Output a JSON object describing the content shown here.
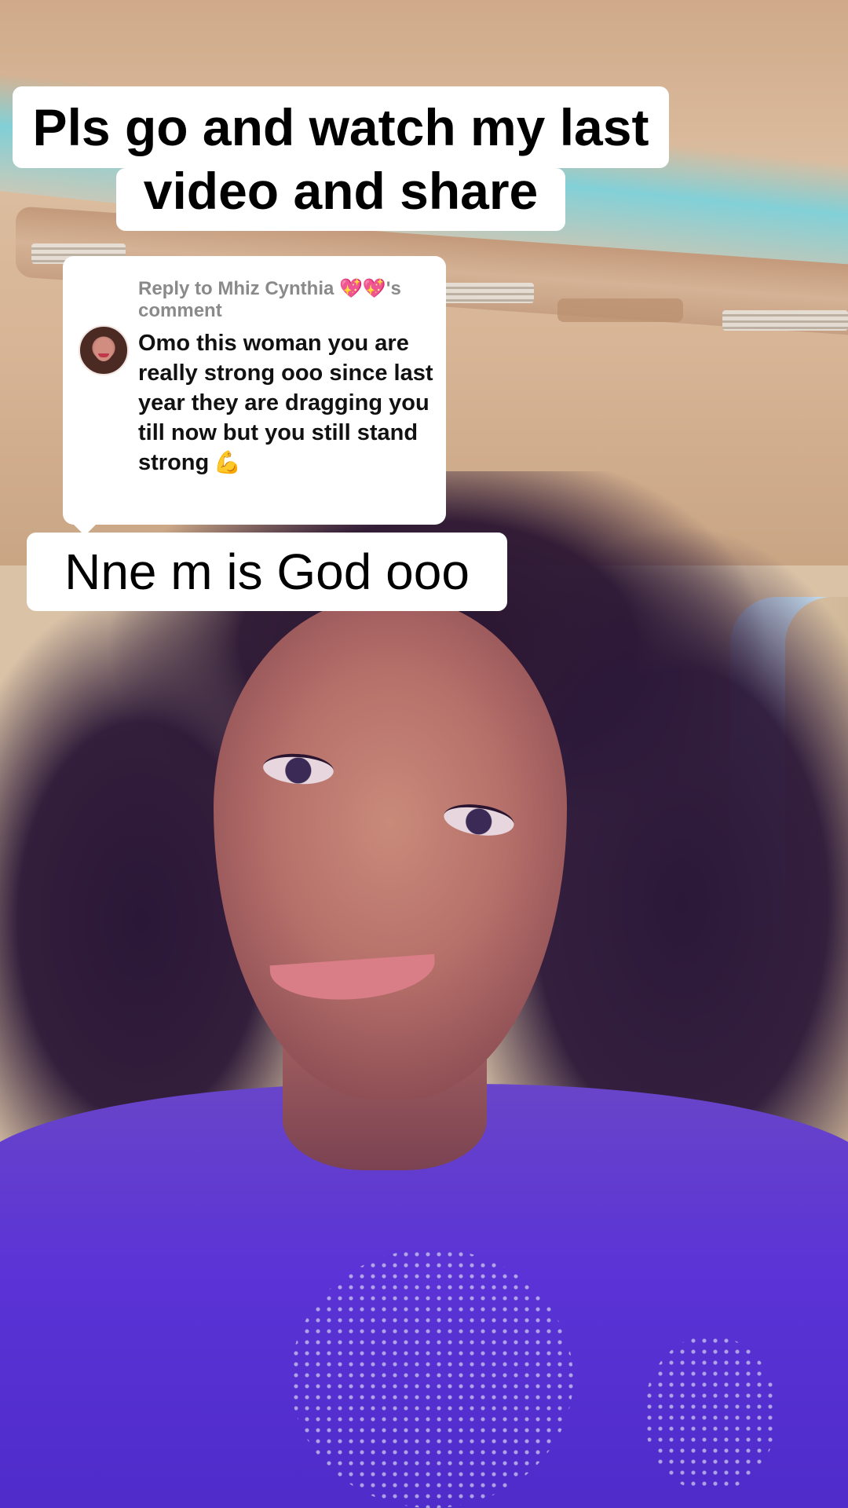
{
  "captions": {
    "line1": "Pls go and watch my last",
    "line2": "video and share",
    "line3": "Nne m is God ooo"
  },
  "reply": {
    "prefix": "Reply to Mhiz Cynthia ",
    "hearts": "💖💖",
    "suffix": "'s comment",
    "comment": "Omo this woman you are really strong ooo since last year they are dragging you till now but you still stand strong",
    "emoji": "💪",
    "avatar_icon": "user-avatar-icon"
  },
  "colors": {
    "caption_bg": "#ffffff",
    "caption_text": "#000000",
    "reply_meta_text": "#8a8a8a",
    "shirt": "#5b33d6"
  }
}
